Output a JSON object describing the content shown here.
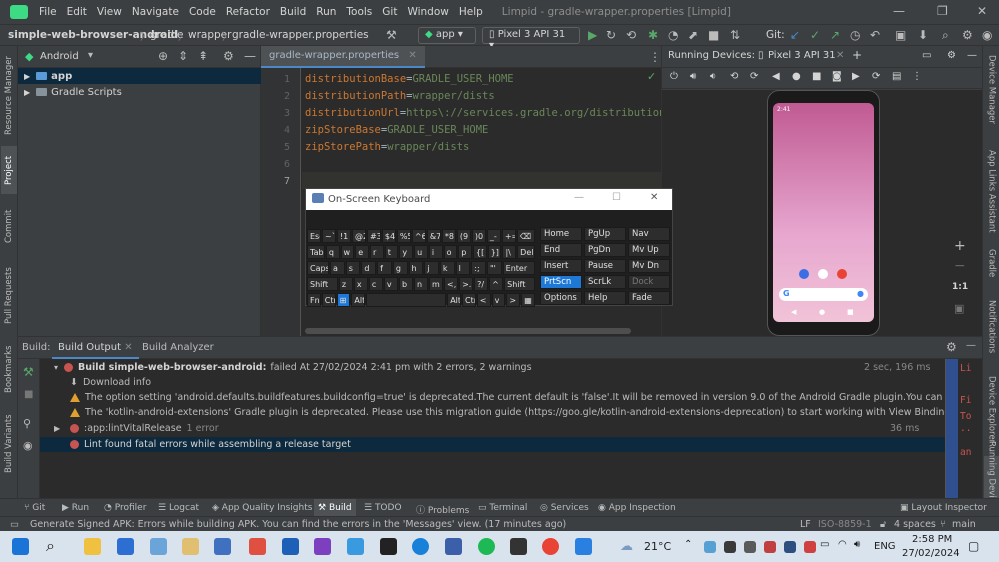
{
  "menubar": {
    "items": [
      "File",
      "Edit",
      "View",
      "Navigate",
      "Code",
      "Refactor",
      "Build",
      "Run",
      "Tools",
      "Git",
      "Window",
      "Help"
    ],
    "window_title": "Limpid - gradle-wrapper.properties [Limpid]"
  },
  "navbar": {
    "breadcrumbs": [
      "simple-web-browser-android",
      "gradle",
      "wrapper",
      "gradle-wrapper.properties"
    ],
    "run_config": "app",
    "device": "Pixel 3 API 31",
    "git_label": "Git:"
  },
  "left_strip": [
    "Resource Manager",
    "Project",
    "Commit",
    "Pull Requests",
    "Bookmarks",
    "Build Variants"
  ],
  "right_strip": [
    "Device Manager",
    "App Links Assistant",
    "Gradle",
    "Notifications",
    "Device Explorer",
    "Running Devices"
  ],
  "project": {
    "view_label": "Android",
    "items": [
      {
        "label": "app"
      },
      {
        "label": "Gradle Scripts"
      }
    ]
  },
  "editor": {
    "tab_label": "gradle-wrapper.properties",
    "lines": [
      {
        "num": "1",
        "key": "distributionBase",
        "val": "GRADLE_USER_HOME"
      },
      {
        "num": "2",
        "key": "distributionPath",
        "val": "wrapper/dists"
      },
      {
        "num": "3",
        "key": "distributionUrl",
        "val": "https\\://services.gradle.org/distribution"
      },
      {
        "num": "4",
        "key": "zipStoreBase",
        "val": "GRADLE_USER_HOME"
      },
      {
        "num": "5",
        "key": "zipStorePath",
        "val": "wrapper/dists"
      },
      {
        "num": "6",
        "key": "",
        "val": ""
      },
      {
        "num": "7",
        "key": "",
        "val": ""
      }
    ]
  },
  "emulator": {
    "header": "Running Devices:",
    "tab": "Pixel 3 API 31",
    "zoom_label": "1:1",
    "phone_time": "2:41"
  },
  "osk": {
    "title": "On-Screen Keyboard",
    "rows": [
      [
        "Esc",
        "~`",
        "!1",
        "@2",
        "#3",
        "$4",
        "%5",
        "^6",
        "&7",
        "*8",
        "(9",
        ")0",
        "_-",
        "+=",
        "⌫"
      ],
      [
        "Tab",
        "q",
        "w",
        "e",
        "r",
        "t",
        "y",
        "u",
        "i",
        "o",
        "p",
        "{[",
        "}]",
        "|\\",
        "Del"
      ],
      [
        "Caps",
        "a",
        "s",
        "d",
        "f",
        "g",
        "h",
        "j",
        "k",
        "l",
        ":;",
        "\"'",
        "Enter"
      ],
      [
        "Shift",
        "z",
        "x",
        "c",
        "v",
        "b",
        "n",
        "m",
        "<,",
        ">.",
        "?/",
        "^",
        "Shift"
      ],
      [
        "Fn",
        "Ctrl",
        "⊞",
        "Alt",
        "",
        "Alt",
        "Ctrl",
        "<",
        "v",
        ">",
        "▦"
      ]
    ],
    "nav_keys": [
      "Home",
      "PgUp",
      "Nav",
      "End",
      "PgDn",
      "Mv Up",
      "Insert",
      "Pause",
      "Mv Dn",
      "PrtScn",
      "ScrLk",
      "Dock",
      "Options",
      "Help",
      "Fade"
    ]
  },
  "build": {
    "label": "Build:",
    "tabs": [
      "Build Output",
      "Build Analyzer"
    ],
    "rows": [
      {
        "type": "error",
        "bold": "Build simple-web-browser-android:",
        "text": "failed At 27/02/2024 2:41 pm with 2 errors, 2 warnings",
        "time": "2 sec, 196 ms"
      },
      {
        "type": "info",
        "text": "Download info"
      },
      {
        "type": "warn",
        "text": "The option setting 'android.defaults.buildfeatures.buildconfig=true' is deprecated.The current default is 'false'.It will be removed in version 9.0 of the Android Gradle plugin.You can resolve this warning in And"
      },
      {
        "type": "warn",
        "text": "The 'kotlin-android-extensions' Gradle plugin is deprecated. Please use this migration guide (https://goo.gle/kotlin-android-extensions-deprecation) to start working with View Binding (https://developer.andr"
      },
      {
        "type": "error",
        "text": ":app:lintVitalRelease",
        "extra": "1 error",
        "time": "36 ms"
      },
      {
        "type": "error",
        "text": "Lint found fatal errors while assembling a release target"
      }
    ],
    "right_lines": [
      "Li",
      "",
      "Fi",
      "To",
      "..",
      "",
      "an"
    ]
  },
  "bottom_tabs": [
    "Git",
    "Run",
    "Profiler",
    "Logcat",
    "App Quality Insights",
    "Build",
    "TODO",
    "Problems",
    "Terminal",
    "Services",
    "App Inspection",
    "Layout Inspector"
  ],
  "status": {
    "message": "Generate Signed APK: Errors while building APK. You can find the errors in the 'Messages' view. (17 minutes ago)",
    "line_sep": "LF",
    "encoding": "ISO-8859-1",
    "indent": "4 spaces",
    "branch": "main"
  },
  "taskbar": {
    "weather": "21°C",
    "lang": "ENG",
    "time": "2:58 PM",
    "date": "27/02/2024"
  },
  "colors": {
    "accent": "#4a88c7",
    "error": "#c75450",
    "warning": "#e0a030",
    "selection": "#0d293e"
  }
}
